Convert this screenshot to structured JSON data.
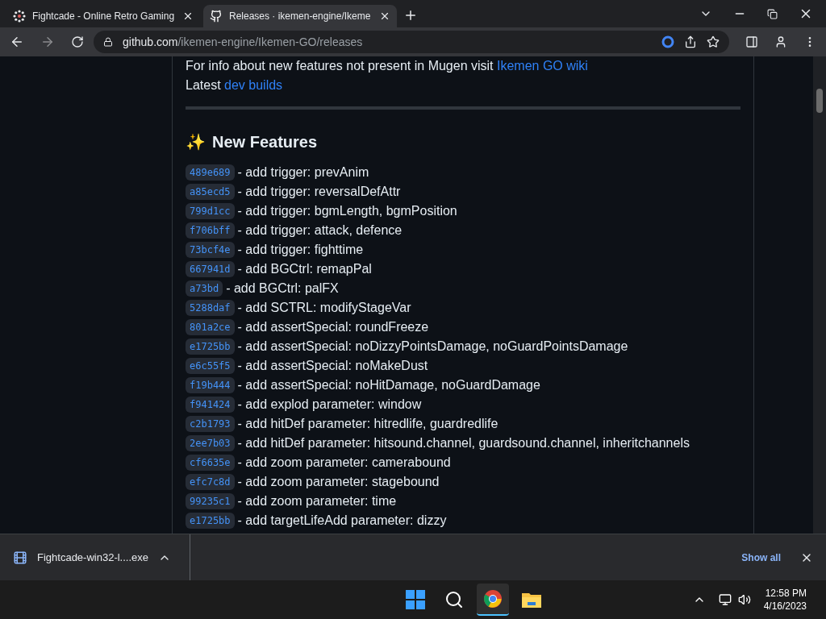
{
  "tabs": [
    {
      "title": "Fightcade - Online Retro Gaming",
      "selected": false,
      "kind": "fightcade"
    },
    {
      "title": "Releases · ikemen-engine/Ikeme",
      "selected": true,
      "kind": "github"
    }
  ],
  "address": {
    "host": "github.com",
    "path": "/ikemen-engine/Ikemen-GO/releases"
  },
  "intro": [
    {
      "text": "For info about new features not present in Mugen visit ",
      "link": "Ikemen GO wiki"
    },
    {
      "text": "Latest ",
      "link": "dev builds"
    }
  ],
  "section": {
    "emoji": "✨",
    "title": "New Features"
  },
  "features": [
    {
      "hash": "489e689",
      "text": "- add trigger: prevAnim"
    },
    {
      "hash": "a85ecd5",
      "text": "- add trigger: reversalDefAttr"
    },
    {
      "hash": "799d1cc",
      "text": "- add trigger: bgmLength, bgmPosition"
    },
    {
      "hash": "f706bff",
      "text": "- add trigger: attack, defence"
    },
    {
      "hash": "73bcf4e",
      "text": "- add trigger: fighttime"
    },
    {
      "hash": "667941d",
      "text": "- add BGCtrl: remapPal"
    },
    {
      "hash": "a73bd",
      "text": "- add BGCtrl: palFX"
    },
    {
      "hash": "5288daf",
      "text": "- add SCTRL: modifyStageVar"
    },
    {
      "hash": "801a2ce",
      "text": "- add assertSpecial: roundFreeze"
    },
    {
      "hash": "e1725bb",
      "text": "- add assertSpecial: noDizzyPointsDamage, noGuardPointsDamage"
    },
    {
      "hash": "e6c55f5",
      "text": "- add assertSpecial: noMakeDust"
    },
    {
      "hash": "f19b444",
      "text": "- add assertSpecial: noHitDamage, noGuardDamage"
    },
    {
      "hash": "f941424",
      "text": "- add explod parameter: window"
    },
    {
      "hash": "c2b1793",
      "text": "- add hitDef parameter: hitredlife, guardredlife"
    },
    {
      "hash": "2ee7b03",
      "text": "- add hitDef parameter: hitsound.channel, guardsound.channel, inheritchannels"
    },
    {
      "hash": "cf6635e",
      "text": "- add zoom parameter: camerabound"
    },
    {
      "hash": "efc7c8d",
      "text": "- add zoom parameter: stagebound"
    },
    {
      "hash": "99235c1",
      "text": "- add zoom parameter: time"
    },
    {
      "hash": "e1725bb",
      "text": "- add targetLifeAdd parameter: dizzy"
    }
  ],
  "download": {
    "file": "Fightcade-win32-l....exe",
    "show_all": "Show all"
  },
  "taskbar": {
    "apps": [
      {
        "kind": "start",
        "selected": false
      },
      {
        "kind": "search",
        "selected": false
      },
      {
        "kind": "chrome",
        "selected": true
      },
      {
        "kind": "explorer",
        "selected": false
      }
    ],
    "time": "12:58 PM",
    "date": "4/16/2023"
  }
}
